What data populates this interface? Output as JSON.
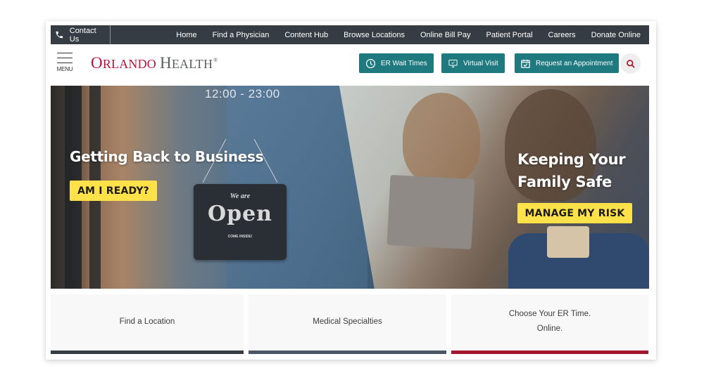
{
  "topbar": {
    "contact_label": "Contact Us",
    "contact_icon": "phone-icon",
    "nav": [
      "Home",
      "Find a Physician",
      "Content Hub",
      "Browse Locations",
      "Online Bill Pay",
      "Patient Portal",
      "Careers",
      "Donate Online"
    ]
  },
  "header": {
    "menu_label": "MENU",
    "logo": {
      "part1_first": "O",
      "part1_rest": "RLANDO",
      "part2_first": "H",
      "part2_rest": "EALTH",
      "registered": "®"
    },
    "buttons": [
      {
        "label": "ER Wait Times",
        "icon": "clock-icon"
      },
      {
        "label": "Virtual Visit",
        "icon": "monitor-icon"
      },
      {
        "label": "Request an Appointment",
        "icon": "calendar-check-icon"
      }
    ],
    "search_icon": "search-icon"
  },
  "hero": {
    "left": {
      "sign_hours": "12:00 - 23:00",
      "sign_we_are": "We are",
      "sign_open": "Open",
      "sign_come_inside": "COME INSIDE!",
      "title": "Getting Back to Business",
      "cta": "AM I READY?"
    },
    "right": {
      "title": "Keeping Your Family Safe",
      "cta": "MANAGE MY RISK"
    }
  },
  "tiles": [
    {
      "label": "Find a Location",
      "bar_color": "#353c44"
    },
    {
      "label": "Medical Specialties",
      "bar_color": "#4a5865"
    },
    {
      "label_line1": "Choose Your ER Time.",
      "label_line2": "Online.",
      "bar_color": "#a3172f"
    }
  ],
  "colors": {
    "brand_red": "#b5133a",
    "teal": "#1f7a80",
    "topbar": "#353c44",
    "cta_yellow": "#ffe14a"
  }
}
